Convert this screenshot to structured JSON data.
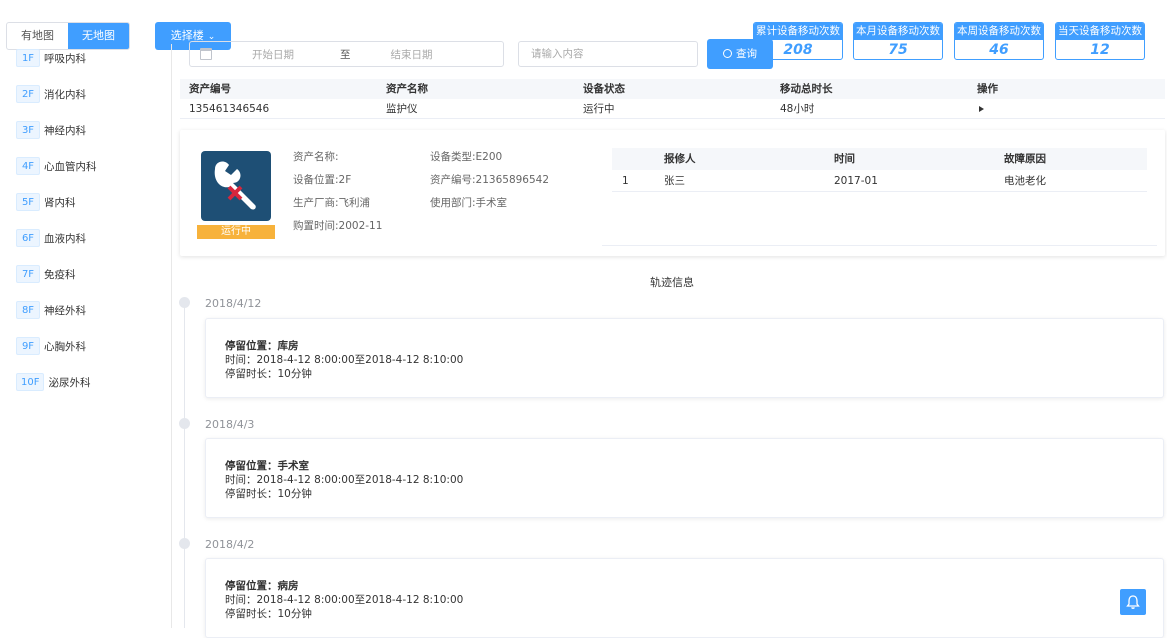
{
  "view_toggle": {
    "map": "有地图",
    "no_map": "无地图",
    "active": "no_map"
  },
  "floor_select": {
    "label": "选择楼"
  },
  "floors": [
    {
      "badge": "1F",
      "name": "呼吸内科"
    },
    {
      "badge": "2F",
      "name": "消化内科"
    },
    {
      "badge": "3F",
      "name": "神经内科"
    },
    {
      "badge": "4F",
      "name": "心血管内科"
    },
    {
      "badge": "5F",
      "name": "肾内科"
    },
    {
      "badge": "6F",
      "name": "血液内科"
    },
    {
      "badge": "7F",
      "name": "免疫科"
    },
    {
      "badge": "8F",
      "name": "神经外科"
    },
    {
      "badge": "9F",
      "name": "心胸外科"
    },
    {
      "badge": "10F",
      "name": "泌尿外科"
    }
  ],
  "stats": [
    {
      "label": "累计设备移动次数",
      "value": "208"
    },
    {
      "label": "本月设备移动次数",
      "value": "75"
    },
    {
      "label": "本周设备移动次数",
      "value": "46"
    },
    {
      "label": "当天设备移动次数",
      "value": "12"
    }
  ],
  "query": {
    "start_placeholder": "开始日期",
    "separator": "至",
    "end_placeholder": "结束日期",
    "search_placeholder": "请输入内容",
    "button": "查询"
  },
  "asset_table": {
    "headers": [
      "资产编号",
      "资产名称",
      "设备状态",
      "移动总时长",
      "操作"
    ],
    "rows": [
      {
        "id": "135461346546",
        "name": "监护仪",
        "status": "运行中",
        "duration": "48小时"
      }
    ]
  },
  "detail": {
    "status": "运行中",
    "asset_name": "资产名称:",
    "location": "设备位置:2F",
    "manufacturer": "生产厂商:飞利浦",
    "purchase": "购置时间:2002-11",
    "type": "设备类型:E200",
    "asset_no": "资产编号:21365896542",
    "department": "使用部门:手术室"
  },
  "repair_table": {
    "headers": [
      "",
      "报修人",
      "时间",
      "故障原因"
    ],
    "rows": [
      {
        "index": "1",
        "person": "张三",
        "time": "2017-01",
        "reason": "电池老化"
      }
    ]
  },
  "trajectory": {
    "title": "轨迹信息",
    "items": [
      {
        "date": "2018/4/12",
        "place": "停留位置：库房",
        "time": "时间：2018-4-12 8:00:00至2018-4-12 8:10:00",
        "duration": "停留时长：10分钟"
      },
      {
        "date": "2018/4/3",
        "place": "停留位置：手术室",
        "time": "时间：2018-4-12 8:00:00至2018-4-12 8:10:00",
        "duration": "停留时长：10分钟"
      },
      {
        "date": "2018/4/2",
        "place": "停留位置：病房",
        "time": "时间：2018-4-12 8:00:00至2018-4-12 8:10:00",
        "duration": "停留时长：10分钟"
      }
    ]
  },
  "colors": {
    "primary": "#409eff",
    "status_tag": "#f7b23b",
    "device_icon_bg": "#1e4f75"
  },
  "icons": [
    "calendar-icon",
    "search-icon",
    "chevron-down-icon",
    "wrench-icon",
    "bell-icon",
    "play-icon"
  ]
}
